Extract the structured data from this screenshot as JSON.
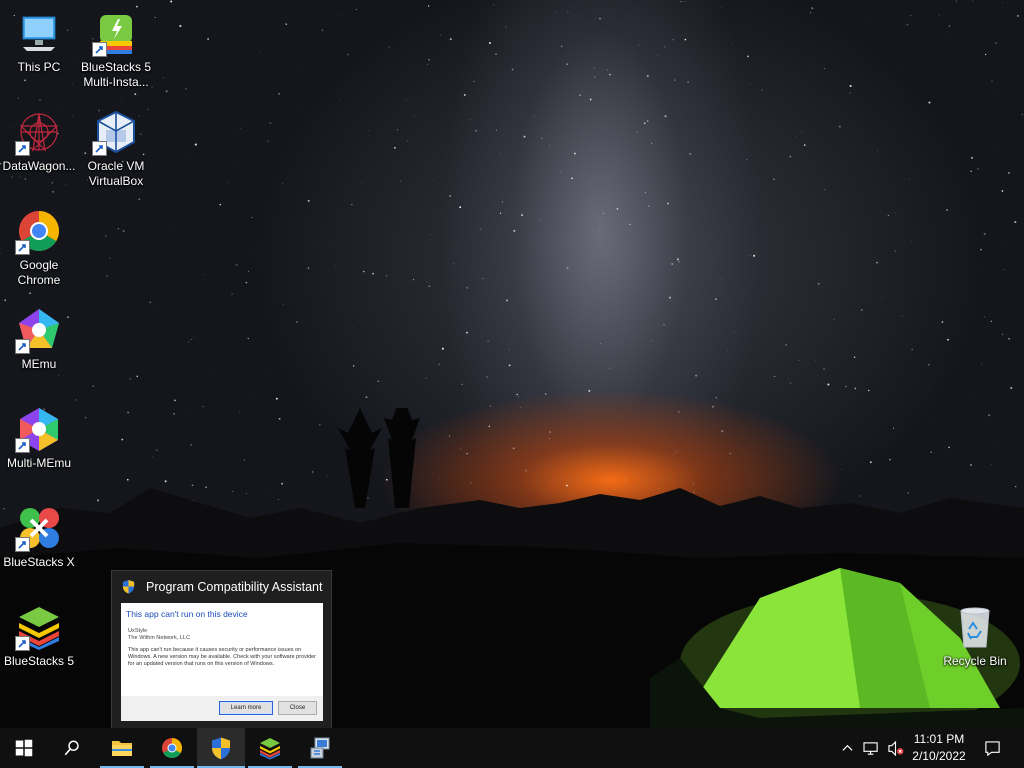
{
  "desktop": {
    "icons": [
      {
        "id": "this-pc",
        "label": "This PC"
      },
      {
        "id": "bluestacks-multi",
        "label": "BlueStacks 5 Multi-Insta..."
      },
      {
        "id": "datawagon",
        "label": "DataWagon..."
      },
      {
        "id": "virtualbox",
        "label": "Oracle VM VirtualBox"
      },
      {
        "id": "chrome",
        "label": "Google Chrome"
      },
      {
        "id": "memu",
        "label": "MEmu"
      },
      {
        "id": "multi-memu",
        "label": "Multi-MEmu"
      },
      {
        "id": "bluestacks-x",
        "label": "BlueStacks X"
      },
      {
        "id": "bluestacks-5",
        "label": "BlueStacks 5"
      },
      {
        "id": "recycle-bin",
        "label": "Recycle Bin"
      }
    ]
  },
  "dialog": {
    "title": "Program Compatibility Assistant",
    "headline": "This app can't run on this device",
    "app_name": "UxStyle",
    "publisher": "The Within Network, LLC",
    "message": "This app can't run because it causes security or performance issues on Windows. A new version may be available. Check with your software provider for an updated version that runs on this version of Windows.",
    "learn_more_label": "Learn more",
    "close_label": "Close"
  },
  "taskbar": {
    "items": [
      {
        "name": "start-button",
        "icon": "windows-logo-icon"
      },
      {
        "name": "search-button",
        "icon": "search-icon"
      },
      {
        "name": "file-explorer",
        "icon": "folder-icon",
        "active": true
      },
      {
        "name": "chrome",
        "icon": "chrome-icon",
        "active": true
      },
      {
        "name": "program-compatibility-assistant",
        "icon": "shield-icon",
        "active": true,
        "focused": true
      },
      {
        "name": "bluestacks",
        "icon": "bluestacks-icon",
        "active": true
      },
      {
        "name": "installer",
        "icon": "installer-icon",
        "active": true
      }
    ],
    "tray_icons": [
      "chevron-up-icon",
      "network-icon",
      "volume-muted-icon",
      "notification-icon"
    ],
    "clock": {
      "time": "11:01 PM",
      "date": "2/10/2022"
    }
  },
  "colors": {
    "taskbar": "#101010",
    "accent": "#76b9ed",
    "dialog_headline": "#1a4eb8"
  }
}
